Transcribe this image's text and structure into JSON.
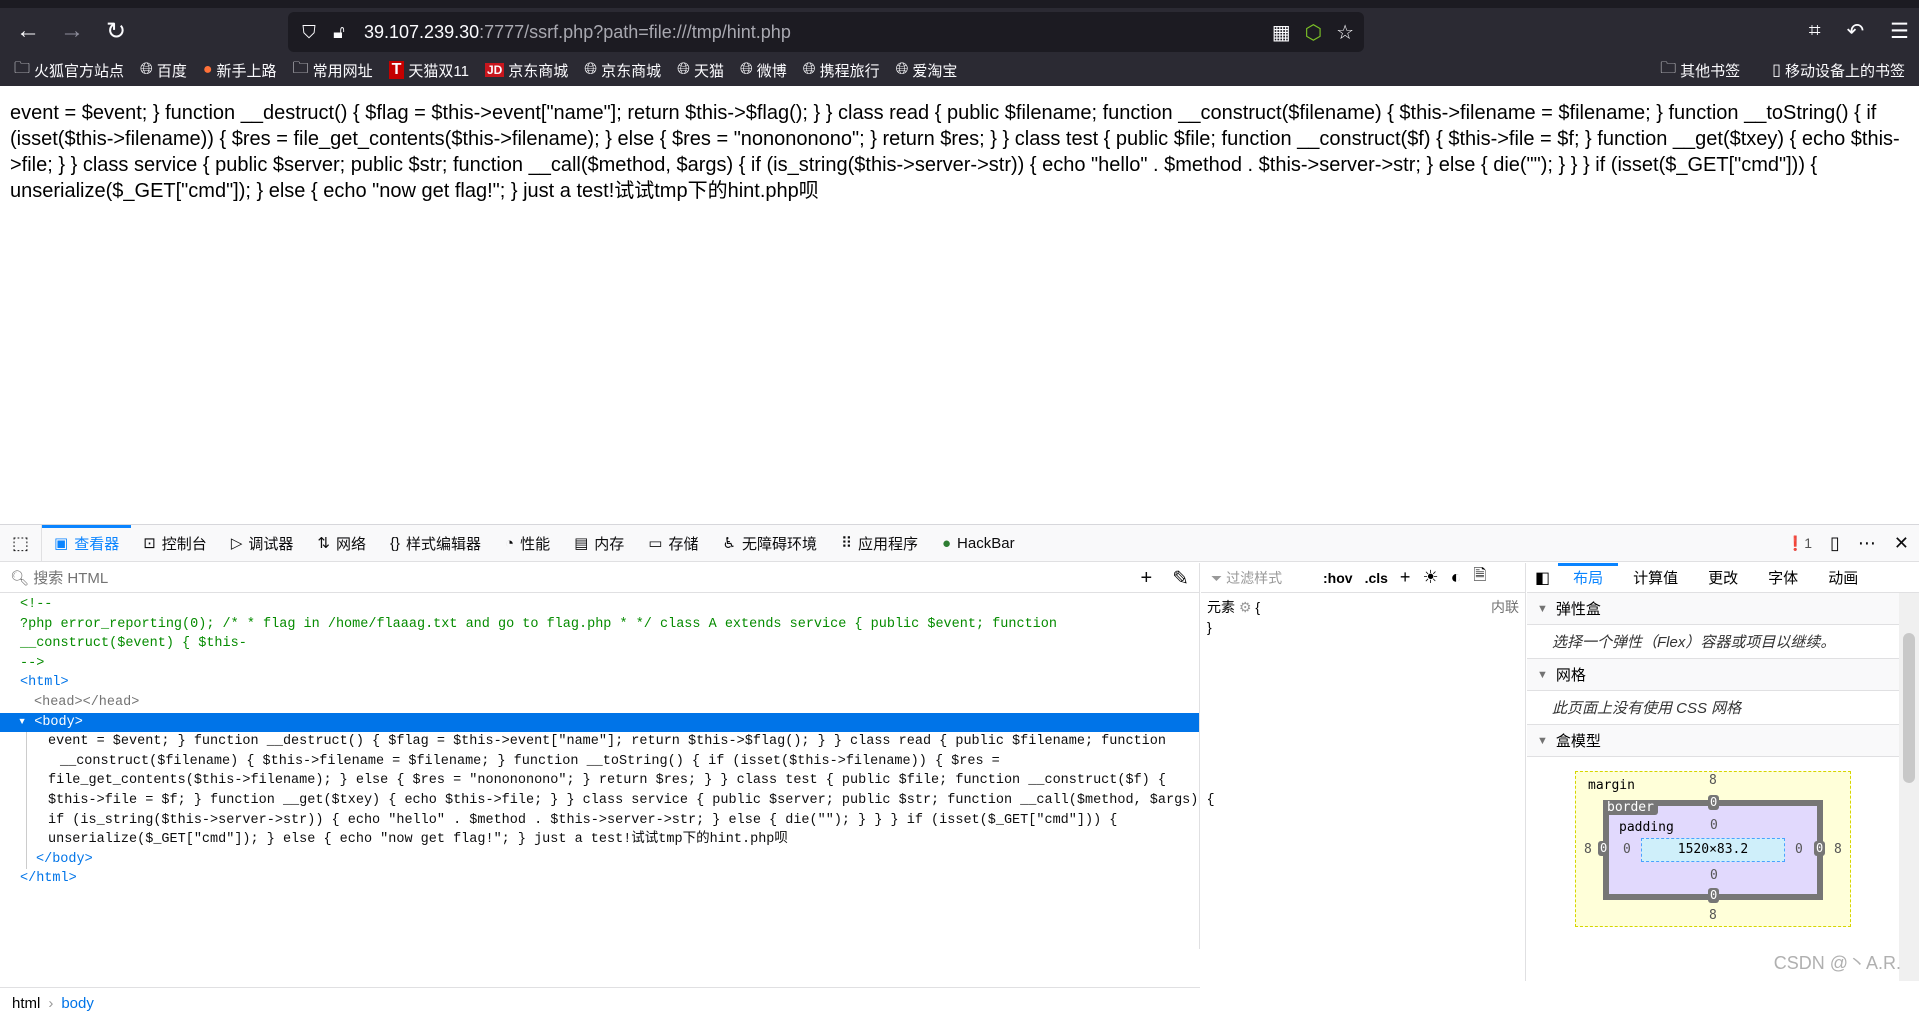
{
  "browser": {
    "url_host": "39.107.239.30",
    "url_rest": ":7777/ssrf.php?path=file:///tmp/hint.php",
    "bookmarks": [
      "火狐官方站点",
      "百度",
      "新手上路",
      "常用网址",
      "天猫双11",
      "京东商城",
      "京东商城",
      "天猫",
      "微博",
      "携程旅行",
      "爱淘宝"
    ],
    "bookmarks_right": [
      "其他书签",
      "移动设备上的书签"
    ]
  },
  "page": {
    "text": "event = $event; } function __destruct() { $flag = $this->event[\"name\"]; return $this->$flag(); } } class read { public $filename; function __construct($filename) { $this->filename = $filename; } function __toString() { if (isset($this->filename)) { $res = file_get_contents($this->filename); } else { $res = \"nonononono\"; } return $res; } } class test { public $file; function __construct($f) { $this->file = $f; } function __get($txey) { echo $this->file; } } class service { public $server; public $str; function __call($method, $args) { if (is_string($this->server->str)) { echo \"hello\" . $method . $this->server->str; } else { die(\"\"); } } } if (isset($_GET[\"cmd\"])) { unserialize($_GET[\"cmd\"]); } else { echo \"now get flag!\"; } just a test!试试tmp下的hint.php呗"
  },
  "devtools": {
    "tabs": [
      "查看器",
      "控制台",
      "调试器",
      "网络",
      "样式编辑器",
      "性能",
      "内存",
      "存储",
      "无障碍环境",
      "应用程序",
      "HackBar"
    ],
    "error_count": "1",
    "search_placeholder": "搜索 HTML",
    "markup": {
      "comment_open": "<!--",
      "comment_lines": [
        "?php error_reporting(0); /* * flag in /home/flaaag.txt and go to flag.php * */ class A extends service { public $event; function",
        "__construct($event) { $this-"
      ],
      "comment_close": "-->",
      "html_open": "<html>",
      "head": "<head></head>",
      "body_open": "<body>",
      "body_lines": [
        "event = $event; } function __destruct() { $flag = $this->event[\"name\"]; return $this->$flag(); } } class read { public $filename; function",
        "__construct($filename) { $this->filename = $filename; } function __toString() { if (isset($this->filename)) { $res =",
        "file_get_contents($this->filename); } else { $res = \"nonononono\"; } return $res; } } class test { public $file; function __construct($f) {",
        "$this->file = $f; } function __get($txey) { echo $this->file; } } class service { public $server; public $str; function __call($method, $args) {",
        "if (is_string($this->server->str)) { echo \"hello\" . $method . $this->server->str; } else { die(\"\"); } } } if (isset($_GET[\"cmd\"])) {",
        "unserialize($_GET[\"cmd\"]); } else { echo \"now get flag!\"; } just a test!试试tmp下的hint.php呗"
      ],
      "body_close": "</body>",
      "html_close": "</html>"
    },
    "breadcrumbs": [
      "html",
      "body"
    ],
    "rules": {
      "filter_placeholder": "过滤样式",
      "hov": ":hov",
      "cls": ".cls",
      "element": "元素",
      "open": "{",
      "close": "}",
      "inline": "内联"
    },
    "layout": {
      "tabs": [
        "布局",
        "计算值",
        "更改",
        "字体",
        "动画"
      ],
      "flex_title": "弹性盒",
      "flex_text": "选择一个弹性（Flex）容器或项目以继续。",
      "grid_title": "网格",
      "grid_text": "此页面上没有使用 CSS 网格",
      "box_title": "盒模型",
      "box": {
        "margin_label": "margin",
        "border_label": "border",
        "padding_label": "padding",
        "size": "1520×83.2",
        "margin": "8",
        "border": "0",
        "padding": "0"
      }
    },
    "accent": "#0074e8"
  },
  "watermark": "CSDN @丶A.R."
}
